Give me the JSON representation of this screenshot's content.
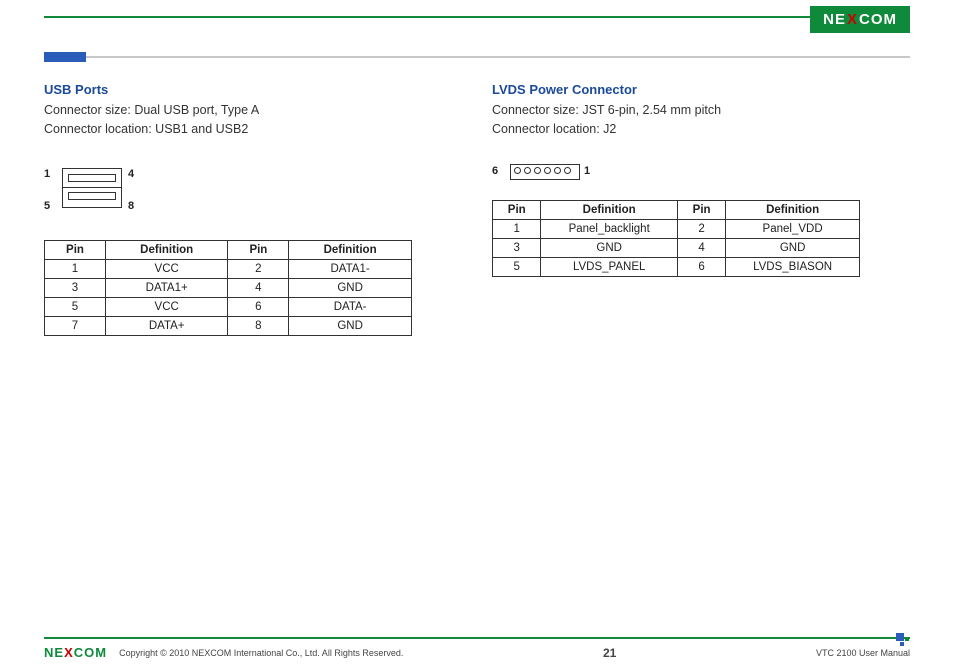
{
  "brand": {
    "logo_pre": "NE",
    "logo_x": "X",
    "logo_post": "COM"
  },
  "left": {
    "title": "USB Ports",
    "size_label": "Connector size: Dual USB port, Type A",
    "loc_label": "Connector location: USB1 and USB2",
    "d1": "1",
    "d4": "4",
    "d5": "5",
    "d8": "8",
    "th_pin": "Pin",
    "th_def": "Definition",
    "rows": [
      {
        "p1": "1",
        "d1": "VCC",
        "p2": "2",
        "d2": "DATA1-"
      },
      {
        "p1": "3",
        "d1": "DATA1+",
        "p2": "4",
        "d2": "GND"
      },
      {
        "p1": "5",
        "d1": "VCC",
        "p2": "6",
        "d2": "DATA-"
      },
      {
        "p1": "7",
        "d1": "DATA+",
        "p2": "8",
        "d2": "GND"
      }
    ]
  },
  "right": {
    "title": "LVDS Power Connector",
    "size_label": "Connector size: JST 6-pin, 2.54 mm pitch",
    "loc_label": "Connector location: J2",
    "d6": "6",
    "d1": "1",
    "th_pin": "Pin",
    "th_def": "Definition",
    "rows": [
      {
        "p1": "1",
        "d1": "Panel_backlight",
        "p2": "2",
        "d2": "Panel_VDD"
      },
      {
        "p1": "3",
        "d1": "GND",
        "p2": "4",
        "d2": "GND"
      },
      {
        "p1": "5",
        "d1": "LVDS_PANEL",
        "p2": "6",
        "d2": "LVDS_BIASON"
      }
    ]
  },
  "footer": {
    "copyright": "Copyright © 2010 NEXCOM International Co., Ltd. All Rights Reserved.",
    "page": "21",
    "manual": "VTC 2100 User Manual"
  }
}
